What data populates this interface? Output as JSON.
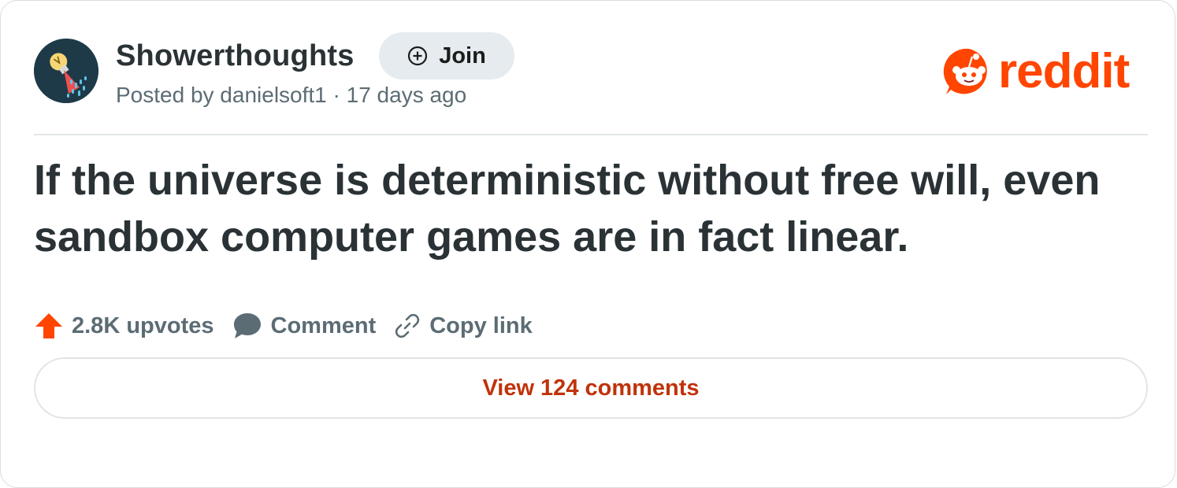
{
  "subreddit": {
    "name": "Showerthoughts",
    "avatar_icon": "lightbulb-shower-icon",
    "join_label": "Join",
    "join_icon": "plus-circle-icon"
  },
  "post": {
    "meta": "Posted by danielsoft1 · 17 days ago",
    "title": "If the universe is deterministic without free will, even sandbox computer games are in fact linear."
  },
  "brand": {
    "wordmark": "reddit",
    "icon": "reddit-snoo-icon",
    "color": "#ff4500"
  },
  "actions": {
    "upvotes": "2.8K upvotes",
    "upvote_icon": "upvote-arrow-icon",
    "upvote_color": "#ff4500",
    "comment": "Comment",
    "comment_icon": "comment-bubble-icon",
    "copy_link": "Copy link",
    "copy_link_icon": "link-icon"
  },
  "footer": {
    "view_comments": "View 124 comments",
    "link_color": "#c0330b"
  }
}
